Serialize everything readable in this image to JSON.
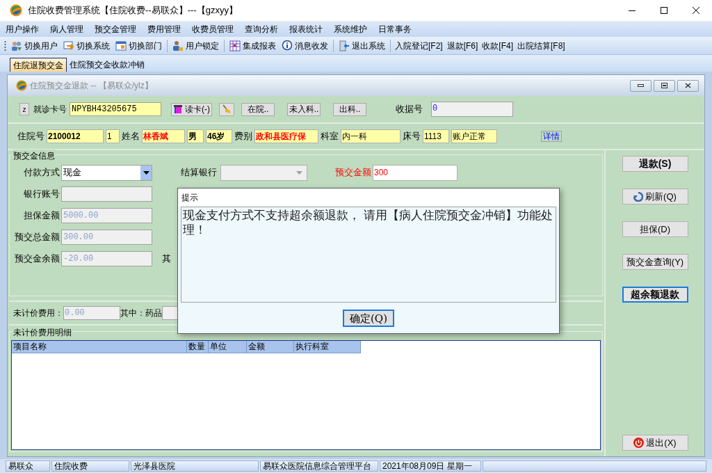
{
  "window": {
    "title": "住院收费管理系统【住院收费--易联众】---【gzxyy】"
  },
  "menu": [
    "用户操作",
    "病人管理",
    "预交金管理",
    "费用管理",
    "收费员管理",
    "查询分析",
    "报表统计",
    "系统维护",
    "日常事务"
  ],
  "toolbar": [
    {
      "kind": "icon",
      "label": "切换用户"
    },
    {
      "kind": "icon",
      "label": "切换系统"
    },
    {
      "kind": "icon",
      "label": "切换部门"
    },
    {
      "kind": "sep"
    },
    {
      "kind": "icon",
      "label": "用户锁定"
    },
    {
      "kind": "sep"
    },
    {
      "kind": "icon",
      "label": "集成报表"
    },
    {
      "kind": "icon",
      "label": "消息收发"
    },
    {
      "kind": "sep"
    },
    {
      "kind": "icon",
      "label": "退出系统"
    },
    {
      "kind": "sep"
    },
    {
      "kind": "text",
      "label": "入院登记[F2]"
    },
    {
      "kind": "text",
      "label": "退款[F6]"
    },
    {
      "kind": "text",
      "label": "收款[F4]"
    },
    {
      "kind": "text",
      "label": "出院结算[F8]"
    }
  ],
  "tabs": [
    {
      "label": "住院退预交金",
      "selected": true
    },
    {
      "label": "住院预交金收款冲销",
      "selected": false
    }
  ],
  "child_window": {
    "title": "住院预交金退款 -- 【易联众/ylz】"
  },
  "card_row": {
    "z_button": "z",
    "card_label": "就诊卡号",
    "card_value": "NPYBH43205675",
    "read_card": "读卡(-)",
    "buttons": [
      "在院..",
      "未入科..",
      "出科.."
    ],
    "receipt_label": "收据号",
    "receipt_value": "0"
  },
  "patient_row": [
    {
      "kind": "label",
      "text": "住院号"
    },
    {
      "kind": "field",
      "text": "2100012",
      "bold": true,
      "alert": false
    },
    {
      "kind": "field",
      "text": "1",
      "bold": false,
      "alert": false
    },
    {
      "kind": "label",
      "text": "姓名"
    },
    {
      "kind": "field",
      "text": "林香斌",
      "bold": true,
      "alert": true
    },
    {
      "kind": "field",
      "text": "男",
      "bold": true,
      "alert": false
    },
    {
      "kind": "field",
      "text": "46岁",
      "bold": true,
      "alert": false
    },
    {
      "kind": "label",
      "text": "费别"
    },
    {
      "kind": "field",
      "text": "政和县医疗保",
      "bold": true,
      "alert": true
    },
    {
      "kind": "label",
      "text": "科室"
    },
    {
      "kind": "field",
      "text": "内一科",
      "bold": false,
      "alert": false
    },
    {
      "kind": "label",
      "text": "床号"
    },
    {
      "kind": "field",
      "text": "1113",
      "bold": false,
      "alert": false
    },
    {
      "kind": "field",
      "text": "账户正常",
      "bold": false,
      "alert": false
    },
    {
      "kind": "link",
      "text": "详情"
    }
  ],
  "prepay": {
    "title": "预交金信息",
    "pay_method": {
      "label": "付款方式",
      "value": "现金"
    },
    "bank": {
      "label": "结算银行",
      "disabled": true
    },
    "amount": {
      "label": "预交金额",
      "value": "300"
    },
    "fields": [
      {
        "label": "银行账号",
        "disabled": true
      },
      {
        "label": "担保金额",
        "value": "5000.00",
        "disabled": true
      },
      {
        "label": "预交总金额",
        "value": "300.00",
        "disabled": true
      },
      {
        "label": "预交金余额",
        "value": "-20.00",
        "disabled": true
      }
    ],
    "cut_label": "其"
  },
  "unpriced": {
    "label": "未计价费用：",
    "value": "0.00",
    "sub_label": "其中：药品"
  },
  "detail": {
    "title": "未计价费用明细",
    "columns": [
      "项目名称",
      "数量",
      "单位",
      "金额",
      "执行科室"
    ]
  },
  "actions": [
    {
      "label": "退款(S)",
      "bold": true,
      "focused": false
    },
    {
      "label": "刷新(Q)",
      "bold": false,
      "focused": false
    },
    {
      "label": "担保(D)",
      "bold": false,
      "focused": false
    },
    {
      "label": "预交金查询(Y)",
      "bold": false,
      "focused": false
    },
    {
      "label": "超余额退款",
      "bold": true,
      "focused": true
    }
  ],
  "exit_button": "退出(X)",
  "dialog": {
    "title": "提示",
    "message": "现金支付方式不支持超余额退款， 请用【病人住院预交金冲销】功能处理！",
    "ok": "确定(Q)"
  },
  "status_bar": [
    "易联众",
    "住院收费",
    "光泽县医院",
    "易联众医院信息综合管理平台",
    "2021年08月09日 星期一"
  ]
}
